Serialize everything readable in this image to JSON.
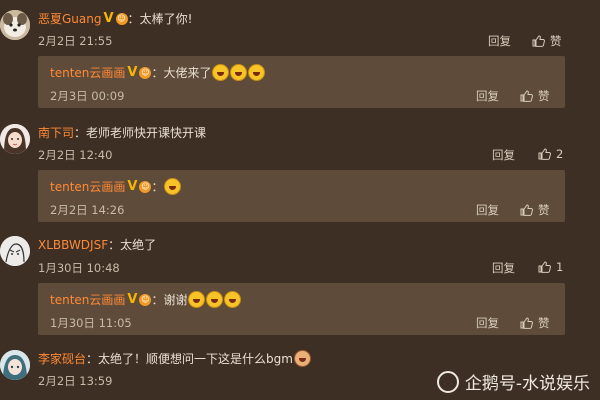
{
  "comments": [
    {
      "user": "恶夏Guang",
      "text": "太棒了你!",
      "time": "2月2日 21:55",
      "reply_label": "回复",
      "like_label": "赞",
      "avatar": "dog-avatar",
      "reply": {
        "user": "tenten云画画",
        "text": "大佬来了",
        "time": "2月3日 00:09",
        "reply_label": "回复",
        "like_label": "赞",
        "emoji_count": 3
      }
    },
    {
      "user": "南下司",
      "text": "老师老师快开课快开课",
      "time": "2月2日 12:40",
      "reply_label": "回复",
      "like_count": "2",
      "avatar": "girl-avatar",
      "reply": {
        "user": "tenten云画画",
        "text": "",
        "time": "2月2日 14:26",
        "reply_label": "回复",
        "like_label": "赞",
        "emoji_count": 1
      }
    },
    {
      "user": "XLBBWDJSF",
      "text": "太绝了",
      "time": "1月30日 10:48",
      "reply_label": "回复",
      "like_count": "1",
      "avatar": "sketch-avatar",
      "reply": {
        "user": "tenten云画画",
        "text": "谢谢",
        "time": "1月30日 11:05",
        "reply_label": "回复",
        "like_label": "赞",
        "emoji_count": 3
      }
    },
    {
      "user": "李家砚台",
      "text": "太绝了！顺便想问一下这是什么bgm",
      "time": "2月2日 13:59",
      "avatar": "anime-avatar"
    }
  ],
  "watermark": "企鹅号-水说娱乐",
  "colors": {
    "background": "#3d2f24",
    "reply_bg": "#5e4b3a",
    "username": "#ff8a36",
    "verified": "#f7b500"
  }
}
